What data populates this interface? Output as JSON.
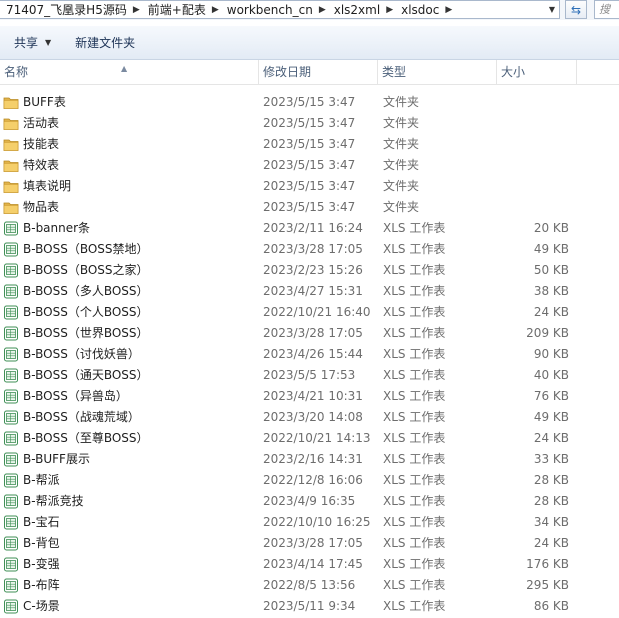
{
  "address": {
    "crumbs": [
      "71407_飞凰录H5源码",
      "前端+配表",
      "workbench_cn",
      "xls2xml",
      "xlsdoc"
    ],
    "search_placeholder": "搜"
  },
  "toolbar": {
    "share_label": "共享",
    "new_folder_label": "新建文件夹"
  },
  "columns": {
    "name": "名称",
    "date": "修改日期",
    "type": "类型",
    "size": "大小"
  },
  "files": [
    {
      "name": "BUFF表",
      "date": "2023/5/15 3:47",
      "type": "文件夹",
      "size": "",
      "icon": "folder-icon"
    },
    {
      "name": "活动表",
      "date": "2023/5/15 3:47",
      "type": "文件夹",
      "size": "",
      "icon": "folder-icon"
    },
    {
      "name": "技能表",
      "date": "2023/5/15 3:47",
      "type": "文件夹",
      "size": "",
      "icon": "folder-icon"
    },
    {
      "name": "特效表",
      "date": "2023/5/15 3:47",
      "type": "文件夹",
      "size": "",
      "icon": "folder-icon"
    },
    {
      "name": "填表说明",
      "date": "2023/5/15 3:47",
      "type": "文件夹",
      "size": "",
      "icon": "folder-icon"
    },
    {
      "name": "物品表",
      "date": "2023/5/15 3:47",
      "type": "文件夹",
      "size": "",
      "icon": "folder-icon"
    },
    {
      "name": "B-banner条",
      "date": "2023/2/11 16:24",
      "type": "XLS 工作表",
      "size": "20 KB",
      "icon": "excel-file-icon"
    },
    {
      "name": "B-BOSS（BOSS禁地）",
      "date": "2023/3/28 17:05",
      "type": "XLS 工作表",
      "size": "49 KB",
      "icon": "excel-file-icon"
    },
    {
      "name": "B-BOSS（BOSS之家）",
      "date": "2023/2/23 15:26",
      "type": "XLS 工作表",
      "size": "50 KB",
      "icon": "excel-file-icon"
    },
    {
      "name": "B-BOSS（多人BOSS）",
      "date": "2023/4/27 15:31",
      "type": "XLS 工作表",
      "size": "38 KB",
      "icon": "excel-file-icon"
    },
    {
      "name": "B-BOSS（个人BOSS）",
      "date": "2022/10/21 16:40",
      "type": "XLS 工作表",
      "size": "24 KB",
      "icon": "excel-file-icon"
    },
    {
      "name": "B-BOSS（世界BOSS）",
      "date": "2023/3/28 17:05",
      "type": "XLS 工作表",
      "size": "209 KB",
      "icon": "excel-file-icon"
    },
    {
      "name": "B-BOSS（讨伐妖兽）",
      "date": "2023/4/26 15:44",
      "type": "XLS 工作表",
      "size": "90 KB",
      "icon": "excel-file-icon"
    },
    {
      "name": "B-BOSS（通天BOSS）",
      "date": "2023/5/5 17:53",
      "type": "XLS 工作表",
      "size": "40 KB",
      "icon": "excel-file-icon"
    },
    {
      "name": "B-BOSS（异兽岛）",
      "date": "2023/4/21 10:31",
      "type": "XLS 工作表",
      "size": "76 KB",
      "icon": "excel-file-icon"
    },
    {
      "name": "B-BOSS（战魂荒域）",
      "date": "2023/3/20 14:08",
      "type": "XLS 工作表",
      "size": "49 KB",
      "icon": "excel-file-icon"
    },
    {
      "name": "B-BOSS（至尊BOSS）",
      "date": "2022/10/21 14:13",
      "type": "XLS 工作表",
      "size": "24 KB",
      "icon": "excel-file-icon"
    },
    {
      "name": "B-BUFF展示",
      "date": "2023/2/16 14:31",
      "type": "XLS 工作表",
      "size": "33 KB",
      "icon": "excel-file-icon"
    },
    {
      "name": "B-帮派",
      "date": "2022/12/8 16:06",
      "type": "XLS 工作表",
      "size": "28 KB",
      "icon": "excel-file-icon"
    },
    {
      "name": "B-帮派竞技",
      "date": "2023/4/9 16:35",
      "type": "XLS 工作表",
      "size": "28 KB",
      "icon": "excel-file-icon"
    },
    {
      "name": "B-宝石",
      "date": "2022/10/10 16:25",
      "type": "XLS 工作表",
      "size": "34 KB",
      "icon": "excel-file-icon"
    },
    {
      "name": "B-背包",
      "date": "2023/3/28 17:05",
      "type": "XLS 工作表",
      "size": "24 KB",
      "icon": "excel-file-icon"
    },
    {
      "name": "B-变强",
      "date": "2023/4/14 17:45",
      "type": "XLS 工作表",
      "size": "176 KB",
      "icon": "excel-file-icon"
    },
    {
      "name": "B-布阵",
      "date": "2022/8/5 13:56",
      "type": "XLS 工作表",
      "size": "295 KB",
      "icon": "excel-file-icon"
    },
    {
      "name": "C-场景",
      "date": "2023/5/11 9:34",
      "type": "XLS 工作表",
      "size": "86 KB",
      "icon": "excel-file-icon"
    }
  ]
}
